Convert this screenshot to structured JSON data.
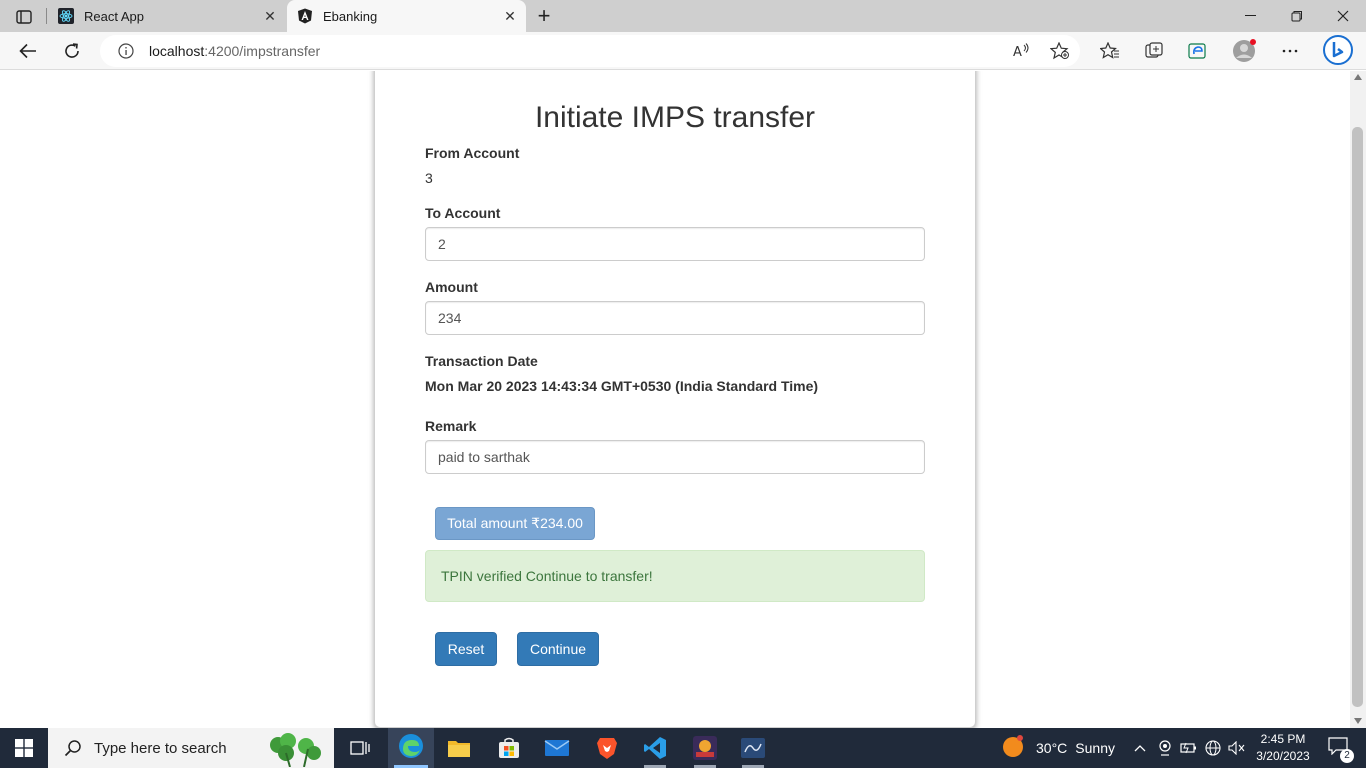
{
  "browser": {
    "tabs": [
      {
        "title": "React App",
        "active": false
      },
      {
        "title": "Ebanking",
        "active": true
      }
    ],
    "address": {
      "host": "localhost",
      "path": ":4200/impstransfer"
    }
  },
  "form": {
    "title": "Initiate IMPS transfer",
    "from_account_label": "From Account",
    "from_account_value": "3",
    "to_account_label": "To Account",
    "to_account_value": "2",
    "amount_label": "Amount",
    "amount_value": "234",
    "date_label": "Transaction Date",
    "date_value": "Mon Mar 20 2023 14:43:34 GMT+0530 (India Standard Time)",
    "remark_label": "Remark",
    "remark_value": "paid to sarthak",
    "total_button": "Total amount ₹234.00",
    "alert_text": "TPIN verified Continue to transfer!",
    "reset_button": "Reset",
    "continue_button": "Continue"
  },
  "taskbar": {
    "search_placeholder": "Type here to search",
    "weather_temp": "30°C",
    "weather_desc": "Sunny",
    "time": "2:45 PM",
    "date": "3/20/2023",
    "notification_count": "2"
  },
  "colors": {
    "primary": "#337ab7",
    "success_bg": "#dff0d8",
    "success_text": "#3c763d",
    "taskbar": "#202a3a"
  }
}
